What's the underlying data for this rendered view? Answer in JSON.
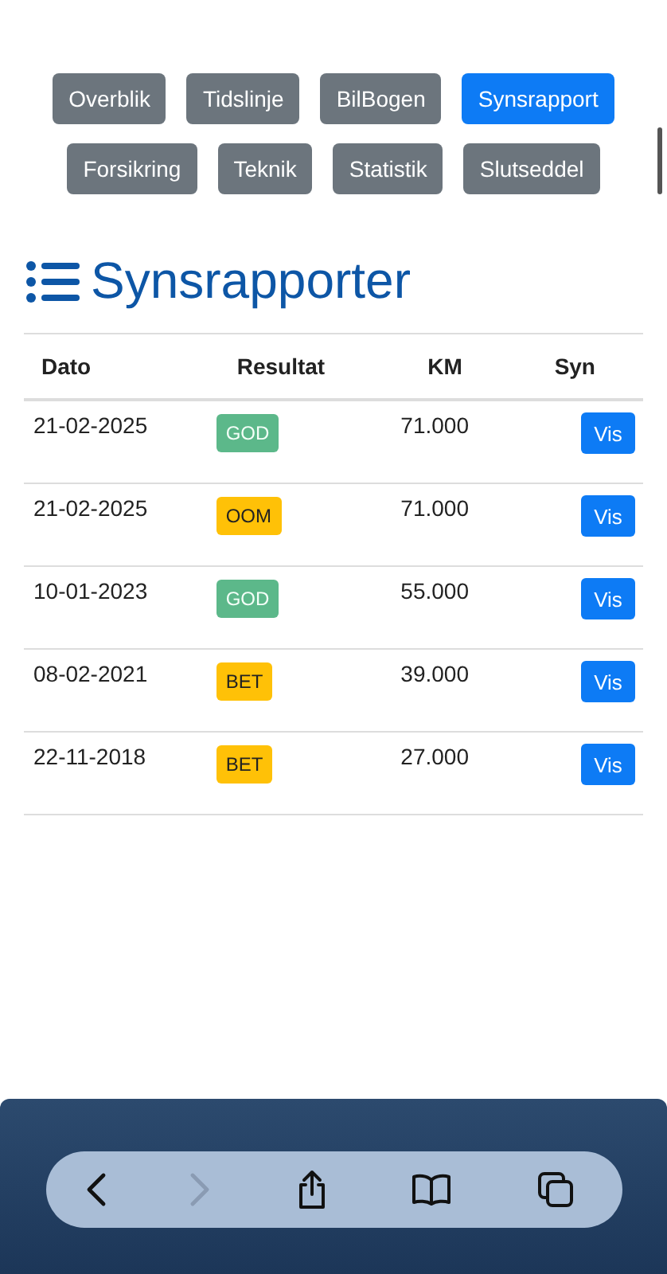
{
  "tabs": [
    {
      "label": "Overblik",
      "selected": false
    },
    {
      "label": "Tidslinje",
      "selected": false
    },
    {
      "label": "BilBogen",
      "selected": false
    },
    {
      "label": "Synsrapport",
      "selected": true
    },
    {
      "label": "Forsikring",
      "selected": false
    },
    {
      "label": "Teknik",
      "selected": false
    },
    {
      "label": "Statistik",
      "selected": false
    },
    {
      "label": "Slutseddel",
      "selected": false
    }
  ],
  "heading": "Synsrapporter",
  "table": {
    "columns": [
      "Dato",
      "Resultat",
      "KM",
      "Syn"
    ],
    "rows": [
      {
        "date": "21-02-2025",
        "result": {
          "label": "GOD",
          "kind": "good"
        },
        "km": "71.000",
        "action": "Vis"
      },
      {
        "date": "21-02-2025",
        "result": {
          "label": "OOM",
          "kind": "warn"
        },
        "km": "71.000",
        "action": "Vis"
      },
      {
        "date": "10-01-2023",
        "result": {
          "label": "GOD",
          "kind": "good"
        },
        "km": "55.000",
        "action": "Vis"
      },
      {
        "date": "08-02-2021",
        "result": {
          "label": "BET",
          "kind": "warn"
        },
        "km": "39.000",
        "action": "Vis"
      },
      {
        "date": "22-11-2018",
        "result": {
          "label": "BET",
          "kind": "warn"
        },
        "km": "27.000",
        "action": "Vis"
      }
    ]
  },
  "browser_toolbar": {
    "forward_disabled": true
  }
}
